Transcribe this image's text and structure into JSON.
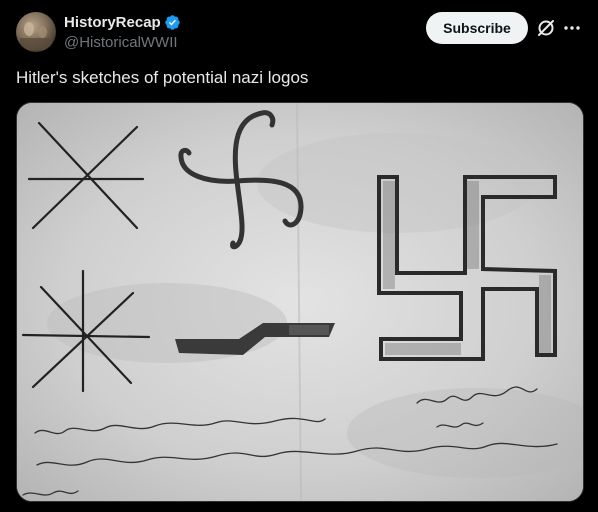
{
  "post": {
    "author": {
      "display_name": "HistoryRecap",
      "handle": "@HistoricalWWII",
      "verified_icon": "verified-badge-icon",
      "avatar_icon": "avatar-image"
    },
    "subscribe_label": "Subscribe",
    "grok_icon": "grok-icon",
    "more_icon": "more-options-icon",
    "text": "Hitler's sketches of potential nazi logos",
    "media": {
      "description_icon": "sketch-image"
    }
  },
  "colors": {
    "background": "#000000",
    "text_primary": "#e7e9ea",
    "text_secondary": "#71767b",
    "accent_verified": "#1d9bf0",
    "button_bg": "#eff3f4",
    "button_text": "#0f1419"
  }
}
